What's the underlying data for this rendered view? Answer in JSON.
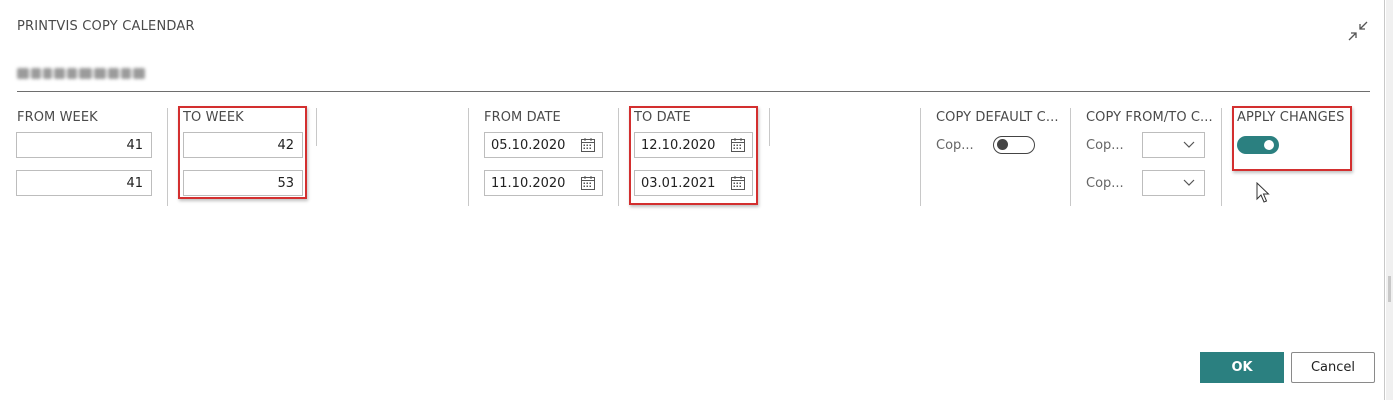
{
  "dialog": {
    "title": "PRINTVIS COPY CALENDAR",
    "subtitle_blurred": "Cembrit?????"
  },
  "columns": {
    "from_week": {
      "label": "FROM WEEK",
      "values": [
        "41",
        "41"
      ]
    },
    "to_week": {
      "label": "TO WEEK",
      "values": [
        "42",
        "53"
      ]
    },
    "from_date": {
      "label": "FROM DATE",
      "values": [
        "05.10.2020",
        "11.10.2020"
      ]
    },
    "to_date": {
      "label": "TO DATE",
      "values": [
        "12.10.2020",
        "03.01.2021"
      ]
    },
    "copy_default": {
      "label": "COPY DEFAULT C...",
      "row_label": "Cop...",
      "toggle_on": false
    },
    "copy_from_to": {
      "label": "COPY FROM/TO C...",
      "row_labels": [
        "Cop...",
        "Cop..."
      ],
      "values": [
        "",
        ""
      ]
    },
    "apply_changes": {
      "label": "APPLY CHANGES",
      "toggle_on": true
    }
  },
  "actions": {
    "ok_label": "OK",
    "cancel_label": "Cancel"
  },
  "colors": {
    "accent": "#2b8080",
    "highlight": "#d32f2f",
    "divider": "#c8c8c8"
  },
  "icons": {
    "collapse": "collapse-arrows-icon",
    "calendar": "calendar-icon",
    "dropdown": "chevron-down-icon",
    "cursor": "mouse-pointer-icon"
  }
}
